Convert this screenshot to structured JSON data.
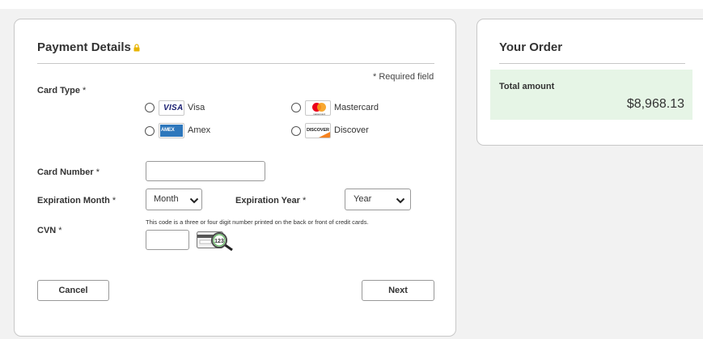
{
  "payment": {
    "title": "Payment Details",
    "required_note": "* Required field",
    "card_type_label": "Card Type",
    "card_options": [
      {
        "label": "Visa",
        "logo_text": "VISA"
      },
      {
        "label": "Mastercard",
        "logo_text": "mastercard"
      },
      {
        "label": "Amex",
        "logo_text": "AMEX"
      },
      {
        "label": "Discover",
        "logo_text": "DISCOVER"
      }
    ],
    "card_number_label": "Card Number",
    "card_number_value": "",
    "exp_month_label": "Expiration Month",
    "exp_month_value": "Month",
    "exp_year_label": "Expiration Year",
    "exp_year_value": "Year",
    "cvn_label": "CVN",
    "cvn_hint": "This code is a three or four digit number printed on the back or front of credit cards.",
    "cvn_value": "",
    "cvn_image_text": "123",
    "required_mark": "*",
    "cancel_label": "Cancel",
    "next_label": "Next"
  },
  "order": {
    "title": "Your Order",
    "total_label": "Total amount",
    "total_amount": "$8,968.13"
  },
  "colors": {
    "lock": "#e8b400",
    "total_bg": "#e6f5e6",
    "visa_blue": "#1a1f71",
    "amex_blue": "#2e77bc",
    "discover_orange": "#f58220"
  }
}
